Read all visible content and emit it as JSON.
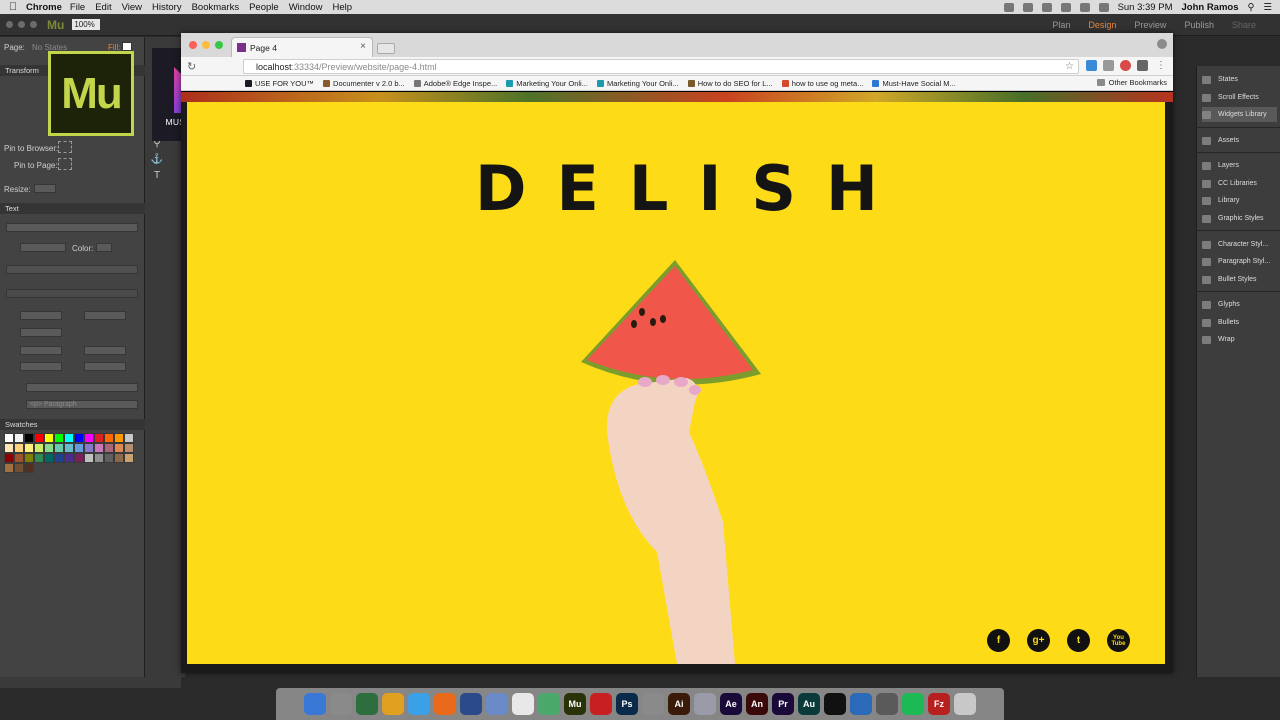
{
  "menubar": {
    "app_name": "Chrome",
    "items": [
      "File",
      "Edit",
      "View",
      "History",
      "Bookmarks",
      "People",
      "Window",
      "Help"
    ],
    "clock": "Sun 3:39 PM",
    "user": "John Ramos"
  },
  "muse_toolbar": {
    "app_mini": "Mu",
    "zoom": "100%",
    "modes": [
      "Plan",
      "Design",
      "Preview",
      "Publish",
      "Share"
    ],
    "active_mode": "Design"
  },
  "left_panel": {
    "page_label": "Page:",
    "page_value": "No States",
    "fill_label": "Fill:",
    "transform_header": "Transform",
    "pin_browser": "Pin to Browser:",
    "pin_page": "Pin to Page:",
    "resize_label": "Resize:",
    "text_header": "Text",
    "color_label": "Color:",
    "paragraph_placeholder": "<p> Paragraph",
    "swatches_header": "Swatches",
    "swatch_colors": [
      "#ffffff",
      "#f2f2f2",
      "#000000",
      "#ff0000",
      "#ffff00",
      "#00ff00",
      "#00ffff",
      "#0000ff",
      "#ff00ff",
      "#e02020",
      "#ff6a00",
      "#ff9900",
      "#c8c8c8",
      "#ffe4b5",
      "#ffd280",
      "#ffee80",
      "#ccee66",
      "#88dd88",
      "#66ccaa",
      "#66bbcc",
      "#6699dd",
      "#8877cc",
      "#cc77bb",
      "#aa6677",
      "#dd8855",
      "#b59070",
      "#8b0000",
      "#a0522d",
      "#808000",
      "#2e8b57",
      "#006666",
      "#1f3f8f",
      "#4b2d8f",
      "#7a1f5c",
      "#c0c0c0",
      "#909090",
      "#606060",
      "#8a6a4a",
      "#c9a070",
      "#a07040",
      "#705030",
      "#503020"
    ]
  },
  "logos": {
    "muse": "Mu",
    "muse_for_you": "MUSE FOR YOU"
  },
  "right_panel": {
    "items": [
      "States",
      "Scroll Effects",
      "Widgets Library",
      "Assets",
      "Layers",
      "CC Libraries",
      "Library",
      "Graphic Styles",
      "Character Styl...",
      "Paragraph Styl...",
      "Bullet Styles",
      "Glyphs",
      "Bullets",
      "Wrap"
    ],
    "selected": "Widgets Library"
  },
  "browser": {
    "tab_title": "Page 4",
    "url_host": "localhost",
    "url_path": ":33334/Preview/website/page-4.html",
    "bookmarks": [
      {
        "label": "USE FOR YOU™",
        "color": "#1c1b25"
      },
      {
        "label": "Documenter v 2.0 b...",
        "color": "#8a5a2a"
      },
      {
        "label": "Adobe® Edge Inspe...",
        "color": "#777777"
      },
      {
        "label": "Marketing Your Onli...",
        "color": "#1a9bb0"
      },
      {
        "label": "Marketing Your Onli...",
        "color": "#1a9bb0"
      },
      {
        "label": "How to do SEO for L...",
        "color": "#7a5a2a"
      },
      {
        "label": "how to use og meta...",
        "color": "#d44a2a"
      },
      {
        "label": "Must-Have Social M...",
        "color": "#2a7ad4"
      }
    ],
    "other_bookmarks": "Other Bookmarks"
  },
  "website": {
    "headline": "DELISH",
    "social": [
      "f",
      "g+",
      "t",
      "You Tube"
    ]
  },
  "dock": {
    "apps": [
      {
        "label": "",
        "color": "#3a78d8"
      },
      {
        "label": "",
        "color": "#8a8a8a"
      },
      {
        "label": "",
        "color": "#2e6e3e"
      },
      {
        "label": "",
        "color": "#e0a020"
      },
      {
        "label": "",
        "color": "#3aa0e8"
      },
      {
        "label": "",
        "color": "#e86a1a"
      },
      {
        "label": "",
        "color": "#2a4a8a"
      },
      {
        "label": "",
        "color": "#6a8ac8"
      },
      {
        "label": "",
        "color": "#e8e8e8"
      },
      {
        "label": "",
        "color": "#4aa86a"
      },
      {
        "label": "Mu",
        "color": "#2a3208"
      },
      {
        "label": "",
        "color": "#c82020"
      },
      {
        "label": "Ps",
        "color": "#0a2a4a"
      },
      {
        "label": "",
        "color": "#8a8a8a"
      },
      {
        "label": "Ai",
        "color": "#3a1a08"
      },
      {
        "label": "",
        "color": "#9a9aa8"
      },
      {
        "label": "Ae",
        "color": "#1a0a3a"
      },
      {
        "label": "An",
        "color": "#3a0a0a"
      },
      {
        "label": "Pr",
        "color": "#1a0a3a"
      },
      {
        "label": "Au",
        "color": "#0a3a3a"
      },
      {
        "label": "",
        "color": "#111111"
      },
      {
        "label": "",
        "color": "#2a6ab8"
      },
      {
        "label": "",
        "color": "#5a5a5a"
      },
      {
        "label": "",
        "color": "#1db954"
      },
      {
        "label": "Fz",
        "color": "#b82020"
      },
      {
        "label": "",
        "color": "#c8c8c8"
      }
    ]
  }
}
